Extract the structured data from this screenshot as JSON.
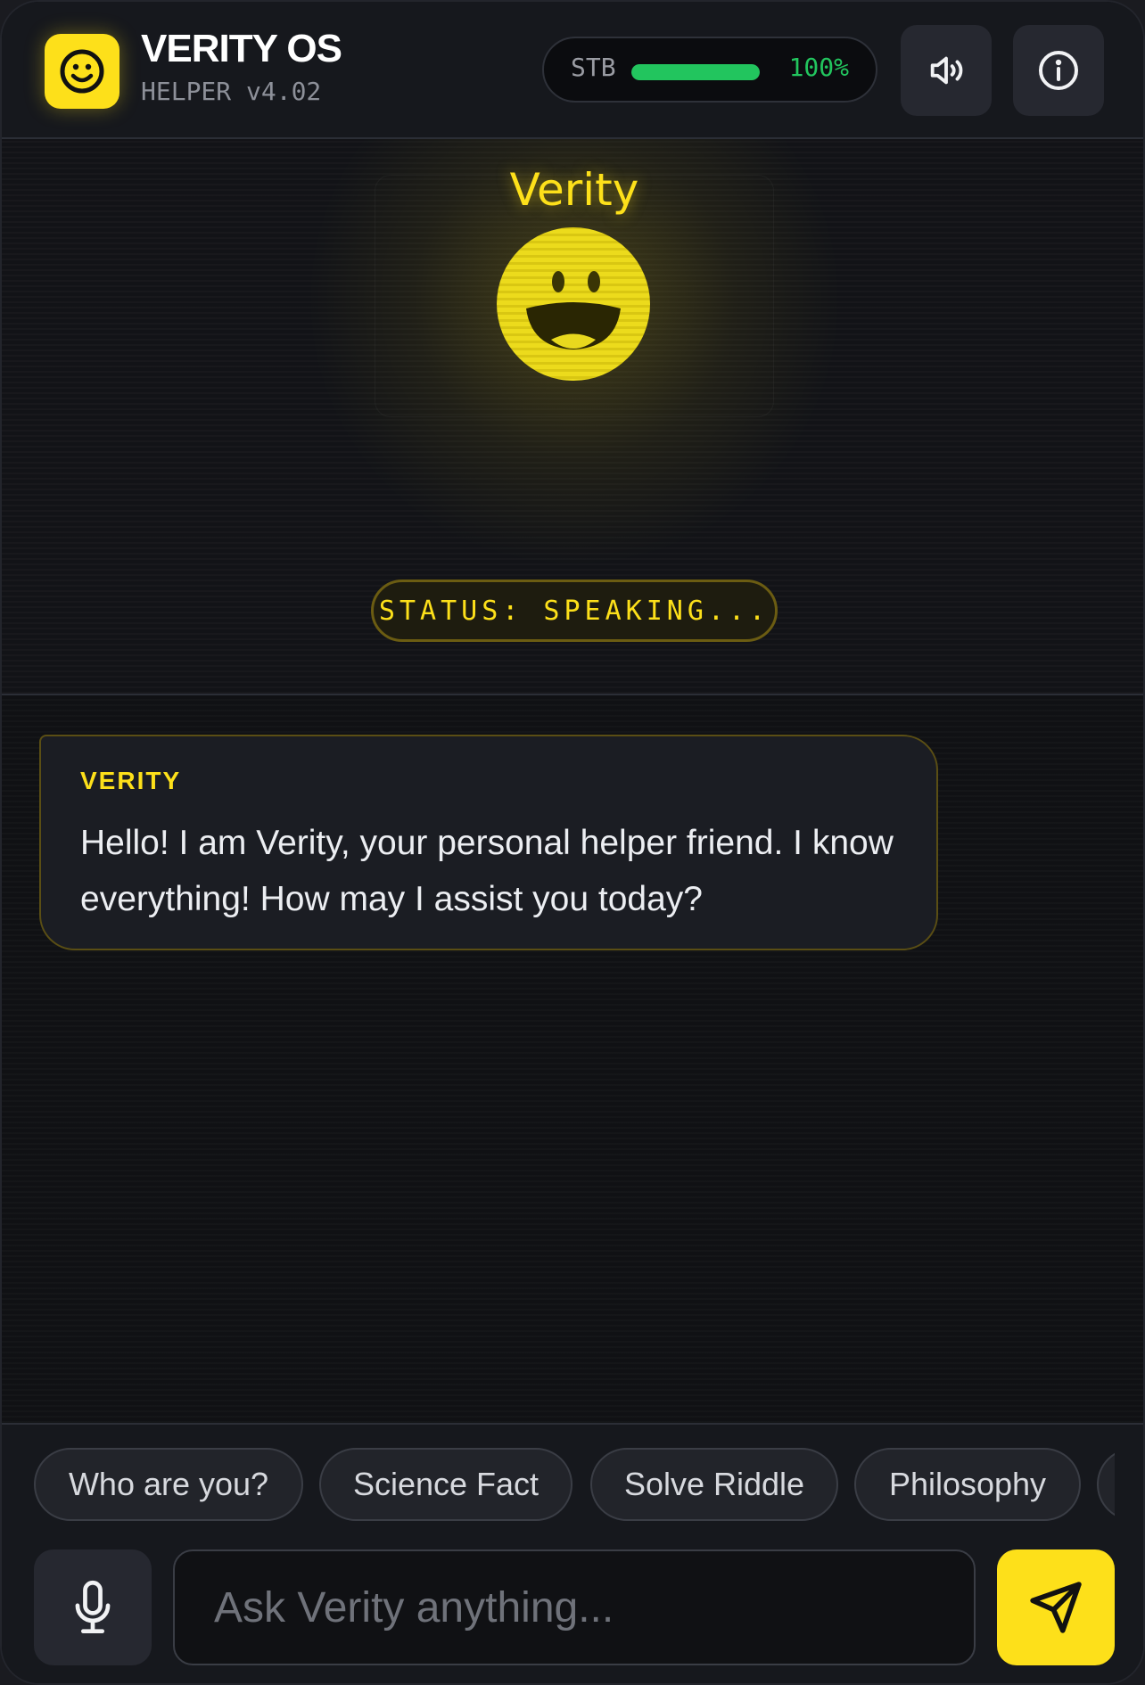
{
  "header": {
    "title": "VERITY OS",
    "subtitle": "HELPER v4.02",
    "stability": {
      "label": "STB",
      "value_text": "100%",
      "fraction": 1.0,
      "color": "#22c55e"
    },
    "icons": {
      "logo": "smiley-icon",
      "sound": "speaker-icon",
      "info": "info-icon"
    }
  },
  "hero": {
    "avatar_name": "Verity",
    "avatar_icon": "grinning-face-icon",
    "status": "STATUS: SPEAKING..."
  },
  "chat": {
    "messages": [
      {
        "sender": "VERITY",
        "text": "Hello! I am Verity, your personal helper friend. I know everything! How may I assist you today?"
      }
    ]
  },
  "suggestions": [
    "Who are you?",
    "Science Fact",
    "Solve Riddle",
    "Philosophy",
    ""
  ],
  "composer": {
    "placeholder": "Ask Verity anything...",
    "mic_icon": "microphone-icon",
    "send_icon": "send-icon"
  },
  "colors": {
    "accent": "#fde01a",
    "background": "#0f1013",
    "success": "#22c55e"
  }
}
